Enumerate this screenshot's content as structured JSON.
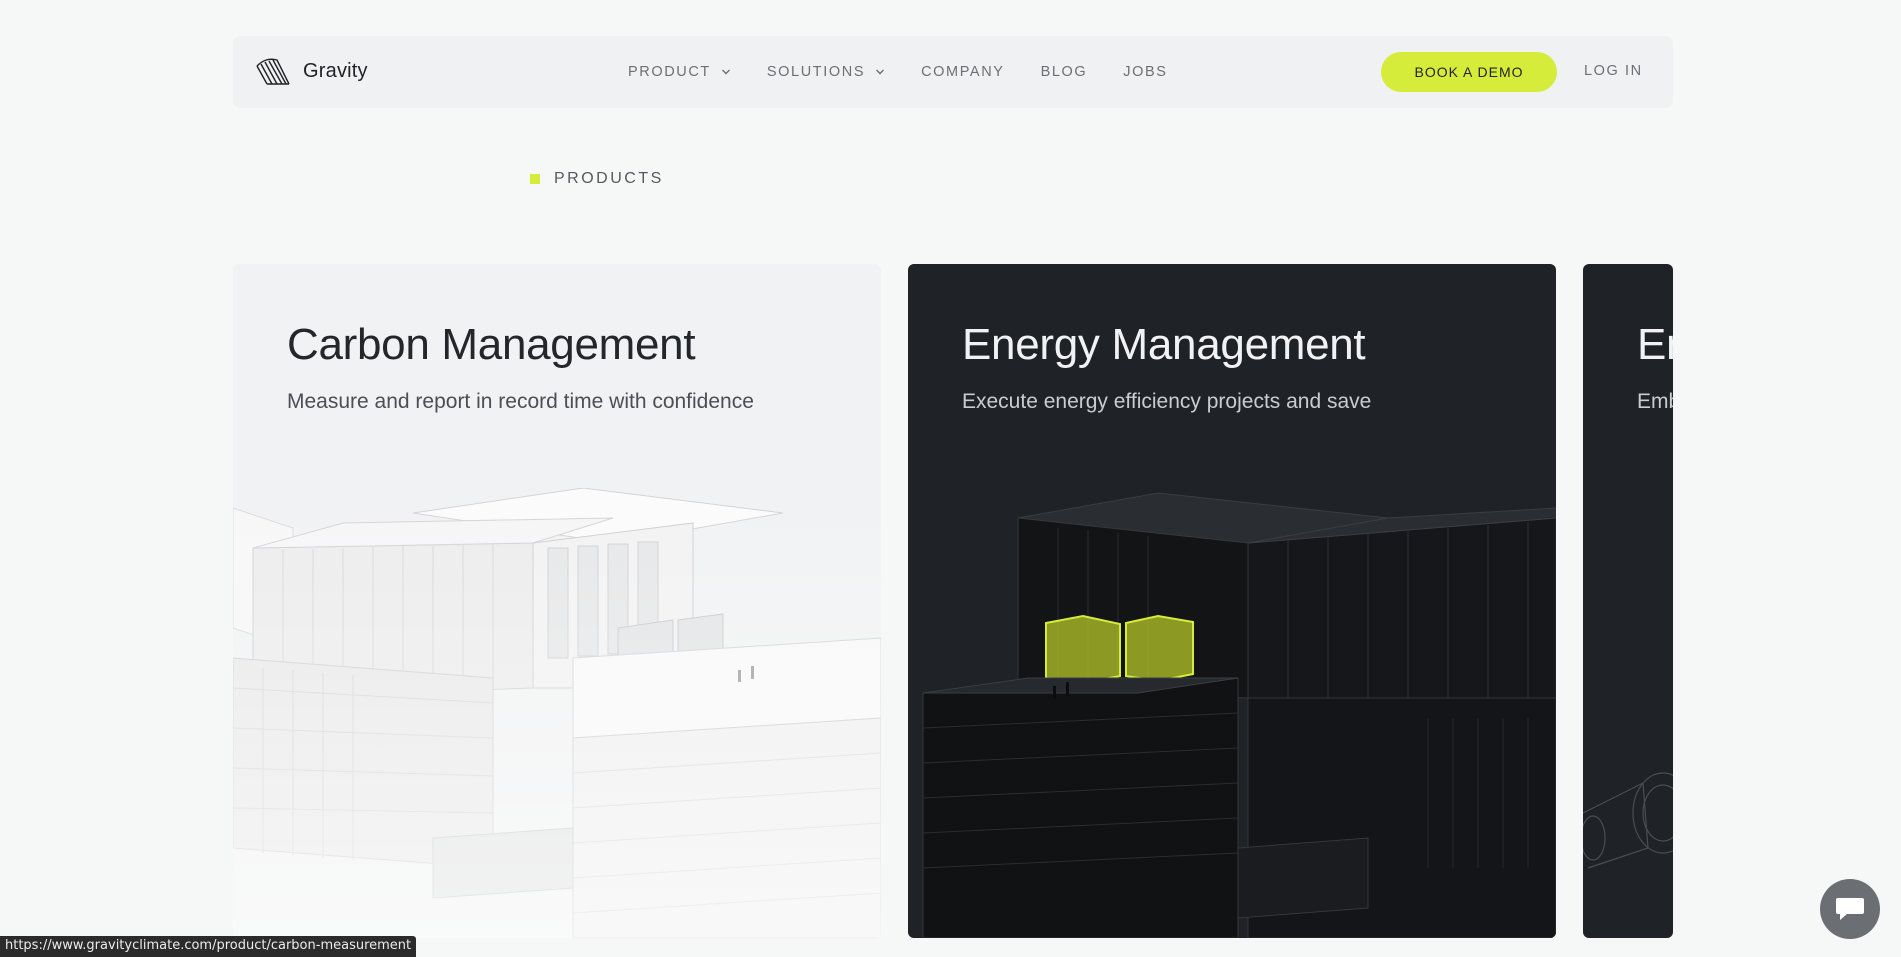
{
  "brand": {
    "name": "Gravity",
    "logo_icon": "gravity-logo-icon"
  },
  "nav": {
    "items": [
      {
        "label": "PRODUCT",
        "dropdown": true
      },
      {
        "label": "SOLUTIONS",
        "dropdown": true
      },
      {
        "label": "COMPANY",
        "dropdown": false
      },
      {
        "label": "BLOG",
        "dropdown": false
      },
      {
        "label": "JOBS",
        "dropdown": false
      }
    ],
    "cta": "BOOK A DEMO",
    "login": "LOG IN"
  },
  "section": {
    "label": "PRODUCTS"
  },
  "cards": [
    {
      "title": "Carbon Management",
      "subtitle": "Measure and report in record time with confidence",
      "theme": "light"
    },
    {
      "title": "Energy Management",
      "subtitle": "Execute energy efficiency projects and save",
      "theme": "dark"
    },
    {
      "title": "En",
      "subtitle": "Emb",
      "theme": "dark"
    }
  ],
  "status_url": "https://www.gravityclimate.com/product/carbon-measurement",
  "chat": {
    "icon": "chat-bubble-icon"
  },
  "colors": {
    "accent": "#d6ec3a",
    "dark_card": "#1f2226",
    "light_card": "#f1f2f3",
    "page_bg": "#f6f8f7"
  }
}
